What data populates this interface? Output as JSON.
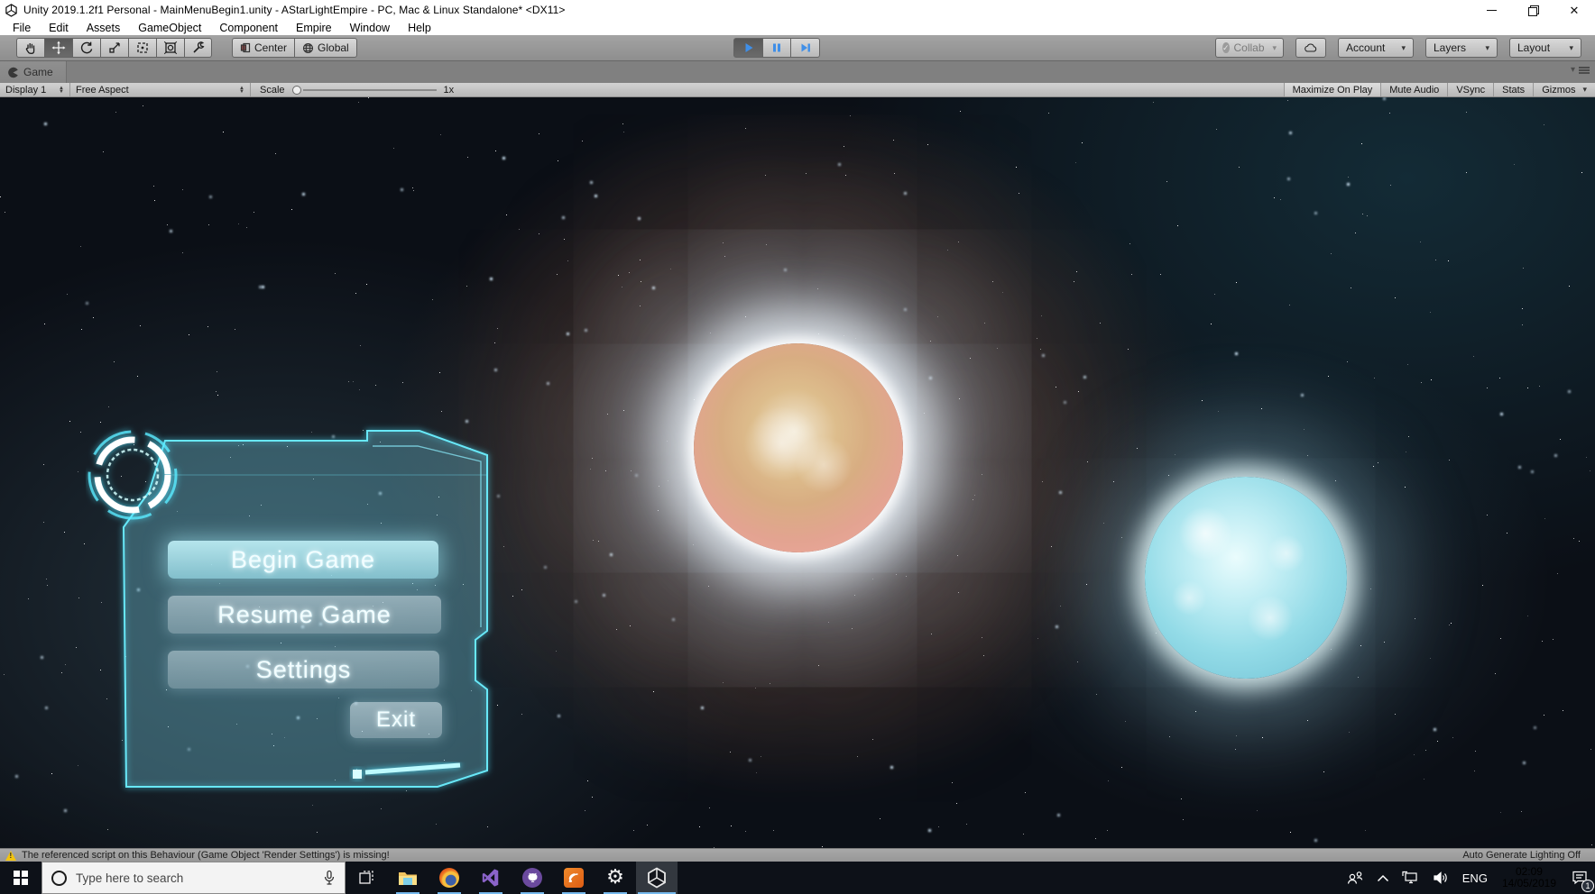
{
  "window": {
    "title": "Unity 2019.1.2f1 Personal - MainMenuBegin1.unity - AStarLightEmpire - PC, Mac & Linux Standalone* <DX11>"
  },
  "menus": [
    "File",
    "Edit",
    "Assets",
    "GameObject",
    "Component",
    "Empire",
    "Window",
    "Help"
  ],
  "toolbar": {
    "center_label": "Center",
    "global_label": "Global",
    "collab_label": "Collab",
    "account_label": "Account",
    "layers_label": "Layers",
    "layout_label": "Layout",
    "tools": [
      "hand-tool",
      "move-tool",
      "rotate-tool",
      "scale-tool",
      "rect-tool",
      "transform-tool",
      "custom-tool"
    ],
    "play_state": "playing"
  },
  "game_view": {
    "tab_label": "Game",
    "display": "Display 1",
    "aspect": "Free Aspect",
    "scale_label": "Scale",
    "scale_value": "1x",
    "maximize": "Maximize On Play",
    "mute": "Mute Audio",
    "vsync": "VSync",
    "stats": "Stats",
    "gizmos": "Gizmos"
  },
  "game_menu": {
    "begin": "Begin Game",
    "resume": "Resume Game",
    "settings": "Settings",
    "exit": "Exit"
  },
  "status_bar": {
    "message": "The referenced script on this Behaviour (Game Object 'Render Settings') is missing!",
    "lighting": "Auto Generate Lighting Off"
  },
  "taskbar": {
    "search_placeholder": "Type here to search",
    "language": "ENG",
    "time": "02:09",
    "date": "14/05/2019",
    "notification_count": "1",
    "pinned_apps": [
      "file-explorer",
      "firefox",
      "visual-studio",
      "github-desktop",
      "rss-app",
      "settings",
      "unity"
    ]
  },
  "colors": {
    "play_accent": "#3f8fe8",
    "menu_accent": "#67e8f8",
    "warning": "#f2c40f",
    "taskbar_indicator": "#76b9ed"
  },
  "icons": [
    "unity-logo-icon",
    "minimize-icon",
    "restore-icon",
    "close-icon",
    "hand-tool-icon",
    "move-tool-icon",
    "rotate-tool-icon",
    "scale-tool-icon",
    "rect-tool-icon",
    "transform-tool-icon",
    "custom-tool-icon",
    "center-pivot-icon",
    "globe-icon",
    "play-icon",
    "pause-icon",
    "step-icon",
    "collab-check-icon",
    "cloud-icon",
    "game-tab-icon",
    "warning-icon",
    "windows-start-icon",
    "cortana-icon",
    "microphone-icon",
    "task-view-icon",
    "folder-icon",
    "firefox-icon",
    "visual-studio-icon",
    "github-icon",
    "rss-icon",
    "gear-icon",
    "people-icon",
    "chevron-up-icon",
    "network-icon",
    "speaker-icon",
    "notification-icon"
  ]
}
